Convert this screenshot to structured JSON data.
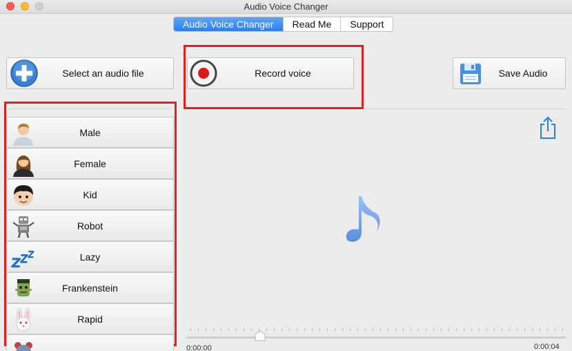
{
  "window": {
    "title": "Audio Voice Changer"
  },
  "tabs": [
    {
      "label": "Audio Voice Changer",
      "active": true
    },
    {
      "label": "Read Me",
      "active": false
    },
    {
      "label": "Support",
      "active": false
    }
  ],
  "toolbar": {
    "select_label": "Select an audio file",
    "record_label": "Record voice",
    "save_label": "Save Audio"
  },
  "voices": [
    {
      "label": "Male",
      "icon": "male-avatar-icon"
    },
    {
      "label": "Female",
      "icon": "female-avatar-icon"
    },
    {
      "label": "Kid",
      "icon": "kid-avatar-icon"
    },
    {
      "label": "Robot",
      "icon": "robot-icon"
    },
    {
      "label": "Lazy",
      "icon": "zzz-sleep-icon"
    },
    {
      "label": "Frankenstein",
      "icon": "frankenstein-icon"
    },
    {
      "label": "Rapid",
      "icon": "rabbit-icon"
    }
  ],
  "player": {
    "current_time": "0:00:00",
    "total_time": "0:00:04",
    "position_fraction": 0.2
  },
  "colors": {
    "accent": "#2a7ef0",
    "highlight_box": "#e02020",
    "music_note": "#6f9fe6"
  }
}
